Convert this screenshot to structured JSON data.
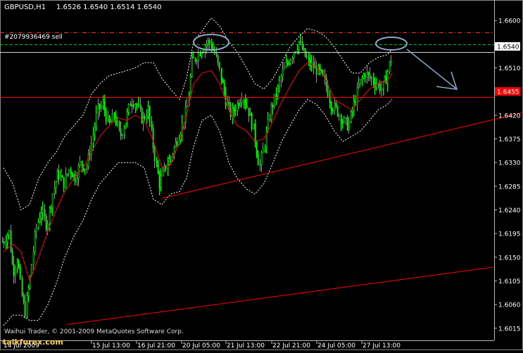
{
  "header": {
    "symbol": "GBPUSD,H1",
    "ohlc": "1.6526 1.6540 1.6514 1.6540"
  },
  "order_label": "#2079936469 sell",
  "current_price_tag": "1.6540",
  "level_price_tag": "1.6455",
  "footer_text": "Waihui Trader, © 2001-2009 MetaQuotes Software Corp.",
  "watermark": "talkforex.com",
  "colors": {
    "background": "#000000",
    "candle": "#00ff00",
    "moving_average": "#ff0000",
    "bands": "#ffffff",
    "trendline": "#ff0000",
    "order_line": "#00cc00",
    "annotation": "#8fa6c8"
  },
  "chart_data": {
    "type": "candlestick",
    "symbol": "GBPUSD",
    "timeframe": "H1",
    "y_ticks": [
      "1.6600",
      "1.6555",
      "1.6510",
      "1.6465",
      "1.6420",
      "1.6375",
      "1.6330",
      "1.6285",
      "1.6240",
      "1.6195",
      "1.6150",
      "1.6105",
      "1.6060",
      "1.6015"
    ],
    "x_ticks": [
      "14 Jul 2009",
      "15 Jul 13:00",
      "16 Jul 21:00",
      "20 Jul 05:00",
      "21 Jul 13:00",
      "22 Jul 21:00",
      "24 Jul 05:00",
      "27 Jul 13:00"
    ],
    "ylim": [
      1.6008,
      1.6615
    ],
    "levels": [
      {
        "name": "resistance",
        "value": 1.6578,
        "style": "dash-dot"
      },
      {
        "name": "order",
        "value": 1.6555,
        "style": "dashed"
      },
      {
        "name": "current",
        "value": 1.654,
        "style": "solid"
      },
      {
        "name": "level",
        "value": 1.6455,
        "style": "solid"
      }
    ],
    "trendlines": [
      {
        "from": [
          230,
          1.6262
        ],
        "to": [
          743,
          1.6425
        ]
      },
      {
        "from": [
          95,
          1.6022
        ],
        "to": [
          700,
          1.6131
        ]
      }
    ],
    "ma_path": [
      [
        5,
        1.616
      ],
      [
        18,
        1.6175
      ],
      [
        30,
        1.616
      ],
      [
        42,
        1.6105
      ],
      [
        55,
        1.615
      ],
      [
        68,
        1.62
      ],
      [
        80,
        1.624
      ],
      [
        92,
        1.6275
      ],
      [
        105,
        1.63
      ],
      [
        118,
        1.632
      ],
      [
        130,
        1.635
      ],
      [
        142,
        1.638
      ],
      [
        155,
        1.64
      ],
      [
        168,
        1.6415
      ],
      [
        180,
        1.641
      ],
      [
        192,
        1.642
      ],
      [
        205,
        1.641
      ],
      [
        218,
        1.637
      ],
      [
        230,
        1.632
      ],
      [
        242,
        1.6325
      ],
      [
        255,
        1.637
      ],
      [
        265,
        1.642
      ],
      [
        275,
        1.648
      ],
      [
        287,
        1.65
      ],
      [
        300,
        1.6505
      ],
      [
        312,
        1.648
      ],
      [
        325,
        1.643
      ],
      [
        337,
        1.64
      ],
      [
        350,
        1.639
      ],
      [
        362,
        1.637
      ],
      [
        375,
        1.6375
      ],
      [
        388,
        1.641
      ],
      [
        400,
        1.6445
      ],
      [
        412,
        1.6475
      ],
      [
        425,
        1.6505
      ],
      [
        437,
        1.652
      ],
      [
        450,
        1.651
      ],
      [
        462,
        1.649
      ],
      [
        475,
        1.645
      ],
      [
        487,
        1.644
      ],
      [
        500,
        1.643
      ],
      [
        512,
        1.645
      ],
      [
        525,
        1.647
      ],
      [
        537,
        1.648
      ],
      [
        550,
        1.6485
      ],
      [
        557,
        1.65
      ]
    ],
    "band_upper": [
      [
        5,
        1.632
      ],
      [
        18,
        1.629
      ],
      [
        30,
        1.624
      ],
      [
        42,
        1.625
      ],
      [
        55,
        1.63
      ],
      [
        68,
        1.633
      ],
      [
        80,
        1.635
      ],
      [
        92,
        1.638
      ],
      [
        105,
        1.64
      ],
      [
        118,
        1.642
      ],
      [
        130,
        1.646
      ],
      [
        142,
        1.648
      ],
      [
        155,
        1.6495
      ],
      [
        168,
        1.65
      ],
      [
        180,
        1.6505
      ],
      [
        192,
        1.651
      ],
      [
        205,
        1.652
      ],
      [
        218,
        1.652
      ],
      [
        230,
        1.649
      ],
      [
        242,
        1.647
      ],
      [
        255,
        1.645
      ],
      [
        265,
        1.649
      ],
      [
        275,
        1.656
      ],
      [
        287,
        1.658
      ],
      [
        300,
        1.6605
      ],
      [
        312,
        1.659
      ],
      [
        325,
        1.656
      ],
      [
        337,
        1.654
      ],
      [
        350,
        1.651
      ],
      [
        362,
        1.648
      ],
      [
        375,
        1.647
      ],
      [
        388,
        1.649
      ],
      [
        400,
        1.652
      ],
      [
        412,
        1.655
      ],
      [
        425,
        1.657
      ],
      [
        437,
        1.6585
      ],
      [
        450,
        1.658
      ],
      [
        462,
        1.657
      ],
      [
        475,
        1.655
      ],
      [
        487,
        1.6525
      ],
      [
        500,
        1.65
      ],
      [
        512,
        1.65
      ],
      [
        525,
        1.652
      ],
      [
        537,
        1.653
      ],
      [
        550,
        1.6535
      ],
      [
        557,
        1.6545
      ]
    ],
    "band_lower": [
      [
        5,
        1.602
      ],
      [
        18,
        1.604
      ],
      [
        30,
        1.604
      ],
      [
        42,
        1.603
      ],
      [
        55,
        1.603
      ],
      [
        68,
        1.606
      ],
      [
        80,
        1.61
      ],
      [
        92,
        1.615
      ],
      [
        105,
        1.619
      ],
      [
        118,
        1.622
      ],
      [
        130,
        1.626
      ],
      [
        142,
        1.629
      ],
      [
        155,
        1.631
      ],
      [
        168,
        1.633
      ],
      [
        180,
        1.633
      ],
      [
        192,
        1.633
      ],
      [
        205,
        1.632
      ],
      [
        218,
        1.626
      ],
      [
        230,
        1.625
      ],
      [
        242,
        1.627
      ],
      [
        255,
        1.6275
      ],
      [
        265,
        1.63
      ],
      [
        275,
        1.636
      ],
      [
        287,
        1.641
      ],
      [
        300,
        1.642
      ],
      [
        312,
        1.639
      ],
      [
        325,
        1.633
      ],
      [
        337,
        1.63
      ],
      [
        350,
        1.628
      ],
      [
        362,
        1.627
      ],
      [
        375,
        1.629
      ],
      [
        388,
        1.633
      ],
      [
        400,
        1.637
      ],
      [
        412,
        1.64
      ],
      [
        425,
        1.643
      ],
      [
        437,
        1.645
      ],
      [
        450,
        1.644
      ],
      [
        462,
        1.642
      ],
      [
        475,
        1.639
      ],
      [
        487,
        1.637
      ],
      [
        500,
        1.638
      ],
      [
        512,
        1.639
      ],
      [
        525,
        1.641
      ],
      [
        537,
        1.643
      ],
      [
        550,
        1.644
      ],
      [
        557,
        1.645
      ]
    ],
    "anchors": [
      [
        5,
        1.618
      ],
      [
        12,
        1.62
      ],
      [
        18,
        1.612
      ],
      [
        24,
        1.615
      ],
      [
        30,
        1.608
      ],
      [
        35,
        1.6045
      ],
      [
        42,
        1.611
      ],
      [
        50,
        1.62
      ],
      [
        58,
        1.624
      ],
      [
        66,
        1.621
      ],
      [
        74,
        1.627
      ],
      [
        82,
        1.631
      ],
      [
        90,
        1.629
      ],
      [
        98,
        1.632
      ],
      [
        106,
        1.63
      ],
      [
        114,
        1.633
      ],
      [
        122,
        1.632
      ],
      [
        130,
        1.637
      ],
      [
        138,
        1.643
      ],
      [
        146,
        1.644
      ],
      [
        154,
        1.64
      ],
      [
        162,
        1.642
      ],
      [
        170,
        1.638
      ],
      [
        178,
        1.641
      ],
      [
        186,
        1.645
      ],
      [
        194,
        1.644
      ],
      [
        202,
        1.641
      ],
      [
        210,
        1.643
      ],
      [
        218,
        1.635
      ],
      [
        226,
        1.629
      ],
      [
        234,
        1.632
      ],
      [
        242,
        1.634
      ],
      [
        250,
        1.637
      ],
      [
        258,
        1.64
      ],
      [
        266,
        1.644
      ],
      [
        272,
        1.652
      ],
      [
        280,
        1.6535
      ],
      [
        288,
        1.655
      ],
      [
        296,
        1.656
      ],
      [
        304,
        1.654
      ],
      [
        312,
        1.65
      ],
      [
        320,
        1.645
      ],
      [
        328,
        1.642
      ],
      [
        336,
        1.644
      ],
      [
        344,
        1.646
      ],
      [
        352,
        1.643
      ],
      [
        360,
        1.639
      ],
      [
        368,
        1.632
      ],
      [
        376,
        1.637
      ],
      [
        384,
        1.643
      ],
      [
        392,
        1.646
      ],
      [
        400,
        1.65
      ],
      [
        408,
        1.652
      ],
      [
        416,
        1.654
      ],
      [
        424,
        1.656
      ],
      [
        430,
        1.654
      ],
      [
        438,
        1.652
      ],
      [
        446,
        1.651
      ],
      [
        454,
        1.65
      ],
      [
        462,
        1.648
      ],
      [
        470,
        1.644
      ],
      [
        478,
        1.643
      ],
      [
        486,
        1.641
      ],
      [
        494,
        1.64
      ],
      [
        502,
        1.644
      ],
      [
        510,
        1.648
      ],
      [
        518,
        1.65
      ],
      [
        526,
        1.649
      ],
      [
        534,
        1.648
      ],
      [
        542,
        1.647
      ],
      [
        548,
        1.649
      ],
      [
        557,
        1.654
      ]
    ],
    "candle_x_range": [
      3,
      557
    ],
    "candle_step": 2.3
  }
}
